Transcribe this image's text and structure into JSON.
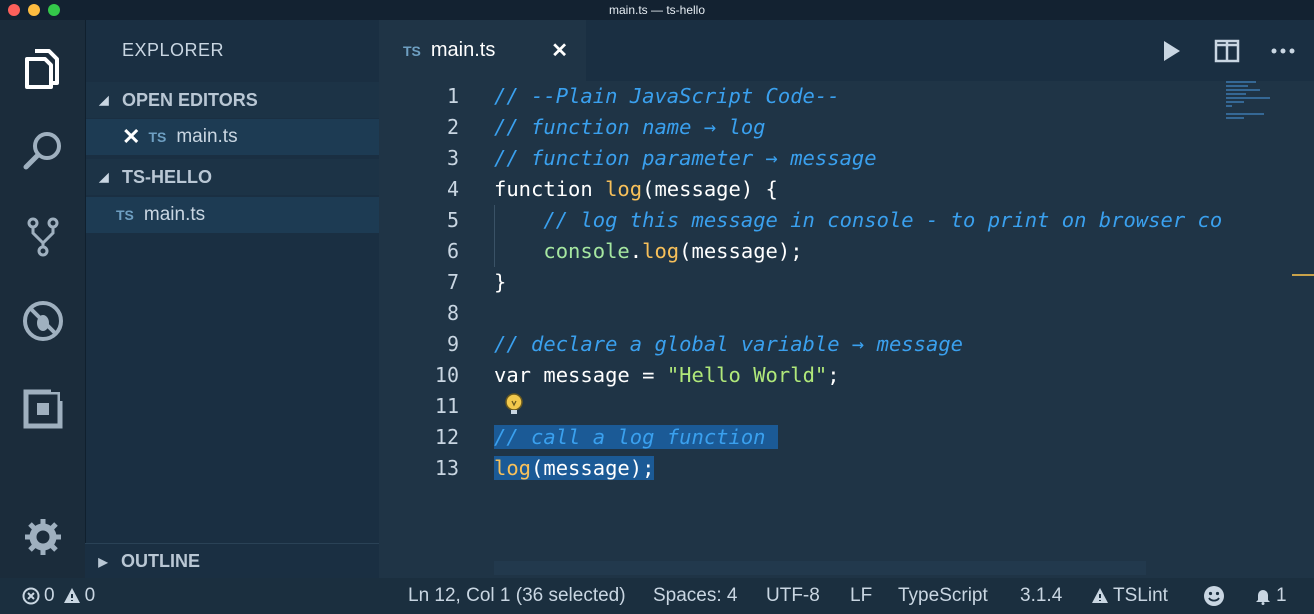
{
  "window": {
    "title": "main.ts — ts-hello"
  },
  "sidebar": {
    "title": "EXPLORER",
    "open_editors_label": "OPEN EDITORS",
    "open_editor_file": {
      "badge": "TS",
      "name": "main.ts"
    },
    "project_label": "TS-HELLO",
    "project_file": {
      "badge": "TS",
      "name": "main.ts"
    },
    "outline_label": "OUTLINE"
  },
  "tab": {
    "badge": "TS",
    "name": "main.ts",
    "close": "✕"
  },
  "editor": {
    "line_numbers": [
      "1",
      "2",
      "3",
      "4",
      "5",
      "6",
      "7",
      "8",
      "9",
      "10",
      "11",
      "12",
      "13"
    ],
    "lines": [
      [
        {
          "t": "// --Plain JavaScript Code--",
          "c": "cmt"
        }
      ],
      [
        {
          "t": "// function name → log",
          "c": "cmt"
        }
      ],
      [
        {
          "t": "// function parameter → message",
          "c": "cmt"
        }
      ],
      [
        {
          "t": "function ",
          "c": "kw"
        },
        {
          "t": "log",
          "c": "fn"
        },
        {
          "t": "(message) {",
          "c": "plain"
        }
      ],
      [
        {
          "t": "    ",
          "c": "plain"
        },
        {
          "t": "// log this message in console - to print on browser co",
          "c": "cmt"
        }
      ],
      [
        {
          "t": "    ",
          "c": "plain"
        },
        {
          "t": "console",
          "c": "obj"
        },
        {
          "t": ".",
          "c": "plain"
        },
        {
          "t": "log",
          "c": "fn"
        },
        {
          "t": "(message);",
          "c": "plain"
        }
      ],
      [
        {
          "t": "}",
          "c": "plain"
        }
      ],
      [],
      [
        {
          "t": "// declare a global variable → message",
          "c": "cmt"
        }
      ],
      [
        {
          "t": "var ",
          "c": "kw"
        },
        {
          "t": "message ",
          "c": "plain"
        },
        {
          "t": "= ",
          "c": "plain"
        },
        {
          "t": "\"Hello World\"",
          "c": "str"
        },
        {
          "t": ";",
          "c": "plain"
        }
      ],
      [],
      [
        {
          "t": "// call a log function ",
          "c": "cmt sel"
        }
      ],
      [
        {
          "t": "log",
          "c": "fn sel"
        },
        {
          "t": "(message);",
          "c": "plain sel"
        }
      ]
    ]
  },
  "status": {
    "errors": "0",
    "warnings": "0",
    "position": "Ln 12, Col 1 (36 selected)",
    "spaces": "Spaces: 4",
    "encoding": "UTF-8",
    "eol": "LF",
    "language": "TypeScript",
    "version": "3.1.4",
    "linter": "TSLint",
    "notifications": "1"
  }
}
